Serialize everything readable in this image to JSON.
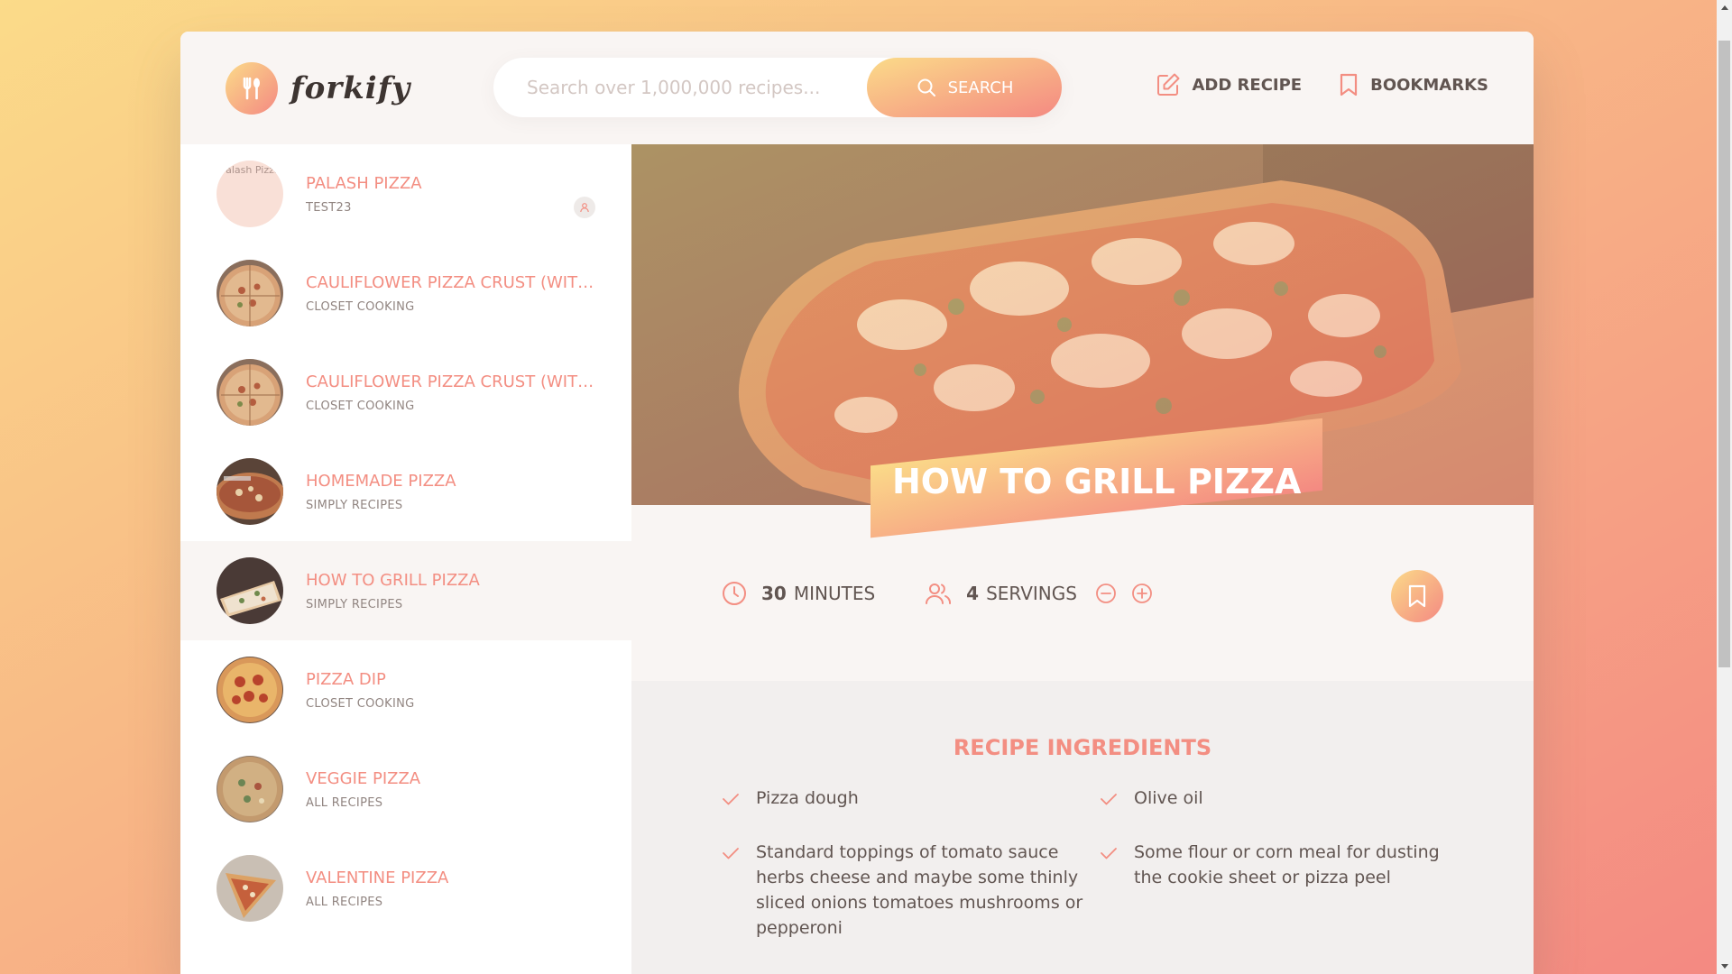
{
  "app": {
    "name": "forkify"
  },
  "search": {
    "placeholder": "Search over 1,000,000 recipes...",
    "button_label": "Search"
  },
  "nav": {
    "add_recipe": "Add recipe",
    "bookmarks": "Bookmarks"
  },
  "results": [
    {
      "title": "Palash Pizza",
      "publisher": "Test23",
      "image_alt": "Palash Pizza",
      "user_generated": true,
      "active": false
    },
    {
      "title": "Cauliflower Pizza Crust (With BBQ Chicken Pizza)",
      "publisher": "Closet Cooking",
      "active": false
    },
    {
      "title": "Cauliflower Pizza Crust (With BBQ Chicken Pizza)",
      "publisher": "Closet Cooking",
      "active": false
    },
    {
      "title": "Homemade Pizza",
      "publisher": "Simply Recipes",
      "active": false
    },
    {
      "title": "How to Grill Pizza",
      "publisher": "Simply Recipes",
      "active": true
    },
    {
      "title": "Pizza Dip",
      "publisher": "Closet Cooking",
      "active": false
    },
    {
      "title": "Veggie Pizza",
      "publisher": "All Recipes",
      "active": false
    },
    {
      "title": "Valentine Pizza",
      "publisher": "All Recipes",
      "active": false
    }
  ],
  "recipe": {
    "title": "How to Grill Pizza",
    "cooking_time": "30",
    "cooking_time_unit": "minutes",
    "servings": "4",
    "servings_unit": "servings",
    "ingredients_heading": "Recipe ingredients",
    "ingredients": [
      "Pizza dough",
      "Olive oil",
      "Standard toppings of tomato sauce herbs cheese and maybe some thinly sliced onions tomatoes mushrooms or pepperoni",
      "Some flour or corn meal for dusting the cookie sheet or pizza peel"
    ]
  },
  "colors": {
    "accent": "#f38e82",
    "gradient_start": "#fbdb89",
    "gradient_end": "#f48982",
    "text": "#615551"
  }
}
